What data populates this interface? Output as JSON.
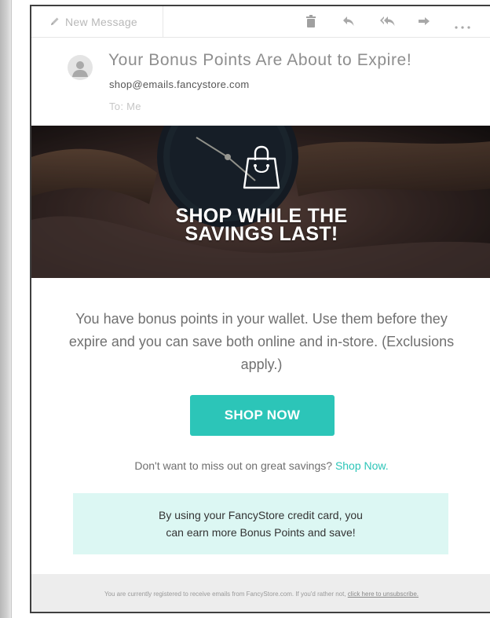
{
  "toolbar": {
    "compose_label": "New Message",
    "actions": [
      "trash-icon",
      "reply-icon",
      "reply-all-icon",
      "forward-icon",
      "more-icon"
    ]
  },
  "email": {
    "subject": "Your Bonus Points Are About to Expire!",
    "from": "shop@emails.fancystore.com",
    "to": "To: Me"
  },
  "hero": {
    "title_line1": "SHOP WHILE THE",
    "title_line2": "SAVINGS LAST!",
    "icon": "shopping-bag-icon"
  },
  "body": {
    "message": "You have bonus points in your wallet. Use them before they expire and you can save both online and in-store. (Exclusions apply.)",
    "cta_label": "SHOP NOW",
    "missout_text": "Don't want to miss out on great savings? ",
    "missout_link": "Shop Now."
  },
  "promo": {
    "line1": "By using your FancyStore credit card, you",
    "line2": "can earn more Bonus Points and save!"
  },
  "footer": {
    "text": "You are currently registered to receive emails from FancyStore.com. If you'd rather not, ",
    "link": "click here to unsubscribe."
  },
  "colors": {
    "accent": "#2cc5b8",
    "promo_bg": "#dcf7f3",
    "footer_bg": "#ededed"
  }
}
